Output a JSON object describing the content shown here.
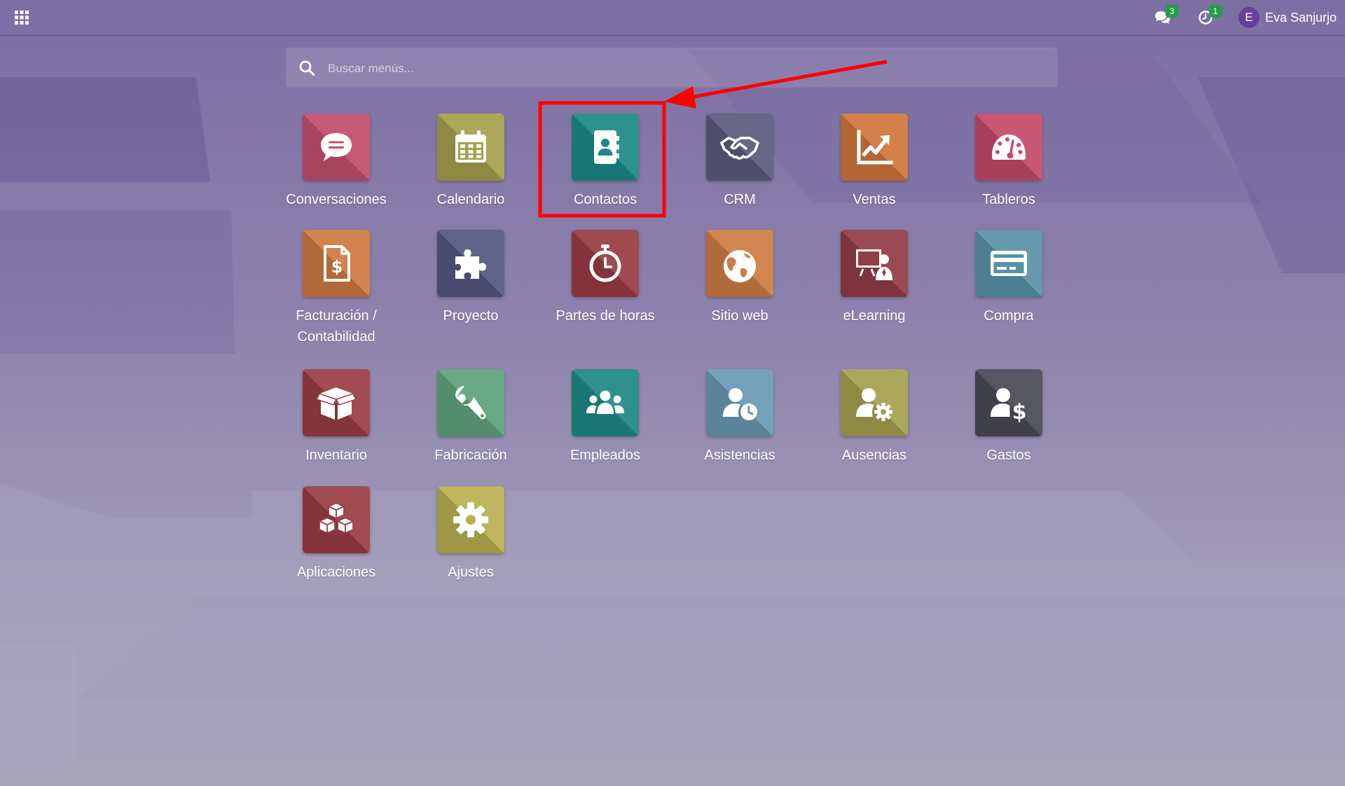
{
  "navbar": {
    "apps_menu_icon": "grid-icon",
    "messages": {
      "icon": "comments-icon",
      "count": "3"
    },
    "activities": {
      "icon": "clock-icon",
      "count": "1"
    },
    "user": {
      "initial": "E",
      "name": "Eva Sanjurjo",
      "avatar_color": "#6a3f99"
    }
  },
  "search": {
    "placeholder": "Buscar menús..."
  },
  "apps": [
    {
      "label": "Conversaciones",
      "icon": "chat-bubble-icon",
      "color": "#c24f6f"
    },
    {
      "label": "Calendario",
      "icon": "calendar-icon",
      "color": "#a6a04e"
    },
    {
      "label": "Contactos",
      "icon": "address-book-icon",
      "color": "#1c8a87"
    },
    {
      "label": "CRM",
      "icon": "handshake-icon",
      "color": "#5c5a7e"
    },
    {
      "label": "Ventas",
      "icon": "chart-up-icon",
      "color": "#d0773c"
    },
    {
      "label": "Tableros",
      "icon": "dashboard-gauge-icon",
      "color": "#c44b6c"
    },
    {
      "label": "Facturación / Contabilidad",
      "icon": "invoice-icon",
      "color": "#cf7a42"
    },
    {
      "label": "Proyecto",
      "icon": "puzzle-icon",
      "color": "#565781"
    },
    {
      "label": "Partes de horas",
      "icon": "stopwatch-icon",
      "color": "#9a3b43"
    },
    {
      "label": "Sitio web",
      "icon": "globe-icon",
      "color": "#cf7d45"
    },
    {
      "label": "eLearning",
      "icon": "teaching-board-icon",
      "color": "#933c46"
    },
    {
      "label": "Compra",
      "icon": "credit-card-icon",
      "color": "#5a91a8"
    },
    {
      "label": "Inventario",
      "icon": "box-icon",
      "color": "#9a3d45"
    },
    {
      "label": "Fabricación",
      "icon": "wrench-icon",
      "color": "#5ea47b"
    },
    {
      "label": "Empleados",
      "icon": "users-icon",
      "color": "#1e8986"
    },
    {
      "label": "Asistencias",
      "icon": "user-clock-icon",
      "color": "#6a9ab4"
    },
    {
      "label": "Ausencias",
      "icon": "user-gear-icon",
      "color": "#a6a04e"
    },
    {
      "label": "Gastos",
      "icon": "user-dollar-icon",
      "color": "#4a4a58"
    },
    {
      "label": "Aplicaciones",
      "icon": "cubes-icon",
      "color": "#9a3d45"
    },
    {
      "label": "Ajustes",
      "icon": "gear-icon",
      "color": "#b8b152"
    }
  ],
  "annotation": {
    "color": "#ff0000",
    "highlighted_app": "Contactos"
  }
}
